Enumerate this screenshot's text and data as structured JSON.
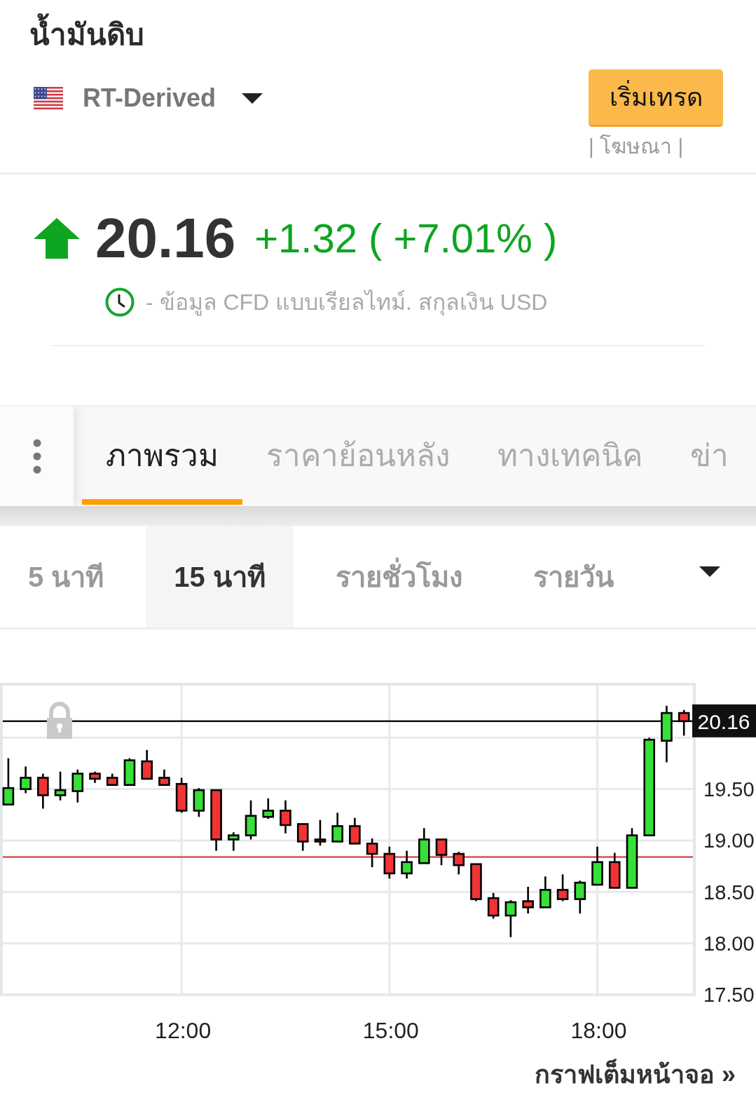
{
  "header": {
    "title": "น้ำมันดิบ",
    "source": "RT-Derived",
    "trade_button": "เริ่มเทรด",
    "ad_note": "| โฆษณา |"
  },
  "quote": {
    "rising": true,
    "price": "20.16",
    "change": "+1.32 ( +7.01% )",
    "info": "- ข้อมูล CFD แบบเรียลไทม์. สกุลเงิน USD"
  },
  "tabs": [
    {
      "label": "ภาพรวม",
      "selected": true
    },
    {
      "label": "ราคาย้อนหลัง",
      "selected": false
    },
    {
      "label": "ทางเทคนิค",
      "selected": false
    },
    {
      "label": "ข่า",
      "selected": false
    }
  ],
  "timeframes": [
    {
      "label": "5 นาที",
      "selected": false
    },
    {
      "label": "15 นาที",
      "selected": true
    },
    {
      "label": "รายชั่วโมง",
      "selected": false
    },
    {
      "label": "รายวัน",
      "selected": false
    }
  ],
  "chart": {
    "chart_data": {
      "type": "candlestick",
      "x": [
        9.5,
        9.75,
        10,
        10.25,
        10.5,
        10.75,
        11,
        11.25,
        11.5,
        11.75,
        12,
        12.25,
        12.5,
        12.75,
        13,
        13.25,
        13.5,
        13.75,
        14,
        14.25,
        14.5,
        14.75,
        15,
        15.25,
        15.5,
        15.75,
        16,
        16.25,
        16.5,
        16.75,
        17,
        17.25,
        17.5,
        17.75,
        18,
        18.25,
        18.5,
        18.75,
        19,
        19.25
      ],
      "ohlc": [
        [
          19.35,
          19.8,
          19.35,
          19.51
        ],
        [
          19.5,
          19.72,
          19.46,
          19.61
        ],
        [
          19.61,
          19.65,
          19.31,
          19.44
        ],
        [
          19.44,
          19.67,
          19.39,
          19.49
        ],
        [
          19.48,
          19.69,
          19.37,
          19.65
        ],
        [
          19.65,
          19.67,
          19.56,
          19.6
        ],
        [
          19.61,
          19.65,
          19.54,
          19.54
        ],
        [
          19.54,
          19.8,
          19.54,
          19.78
        ],
        [
          19.77,
          19.88,
          19.6,
          19.6
        ],
        [
          19.61,
          19.69,
          19.54,
          19.54
        ],
        [
          19.55,
          19.61,
          19.27,
          19.29
        ],
        [
          19.29,
          19.51,
          19.23,
          19.49
        ],
        [
          19.49,
          19.49,
          18.9,
          19.01
        ],
        [
          19.01,
          19.08,
          18.9,
          19.05
        ],
        [
          19.05,
          19.39,
          19.01,
          19.24
        ],
        [
          19.23,
          19.41,
          19.21,
          19.29
        ],
        [
          19.29,
          19.39,
          19.07,
          19.15
        ],
        [
          19.16,
          19.16,
          18.9,
          18.99
        ],
        [
          19.01,
          19.2,
          18.95,
          18.99
        ],
        [
          18.99,
          19.27,
          18.99,
          19.14
        ],
        [
          19.14,
          19.22,
          18.97,
          18.97
        ],
        [
          18.97,
          19.02,
          18.74,
          18.87
        ],
        [
          18.87,
          18.94,
          18.63,
          18.68
        ],
        [
          18.68,
          18.9,
          18.63,
          18.79
        ],
        [
          18.78,
          19.12,
          18.78,
          19.01
        ],
        [
          19.01,
          19.01,
          18.76,
          18.86
        ],
        [
          18.87,
          18.89,
          18.67,
          18.76
        ],
        [
          18.77,
          18.77,
          18.41,
          18.43
        ],
        [
          18.44,
          18.49,
          18.24,
          18.27
        ],
        [
          18.27,
          18.42,
          18.06,
          18.4
        ],
        [
          18.41,
          18.55,
          18.29,
          18.35
        ],
        [
          18.35,
          18.65,
          18.35,
          18.52
        ],
        [
          18.52,
          18.67,
          18.41,
          18.43
        ],
        [
          18.43,
          18.61,
          18.29,
          18.59
        ],
        [
          18.57,
          18.94,
          18.57,
          18.79
        ],
        [
          18.79,
          18.88,
          18.54,
          18.54
        ],
        [
          18.54,
          19.12,
          18.54,
          19.05
        ],
        [
          19.05,
          20.0,
          19.05,
          19.98
        ],
        [
          19.97,
          20.31,
          19.76,
          20.24
        ],
        [
          20.24,
          20.27,
          20.02,
          20.16
        ]
      ],
      "xlim": [
        9.4,
        19.4
      ],
      "ylim": [
        17.5,
        20.52
      ],
      "grid": true,
      "xticks": [
        {
          "value": 12,
          "label": "12:00"
        },
        {
          "value": 15,
          "label": "15:00"
        },
        {
          "value": 18,
          "label": "18:00"
        }
      ],
      "yticks": [
        {
          "value": 17.5,
          "label": "17.50"
        },
        {
          "value": 18,
          "label": "18.00"
        },
        {
          "value": 18.5,
          "label": "18.50"
        },
        {
          "value": 19,
          "label": "19.00"
        },
        {
          "value": 19.5,
          "label": "19.50"
        }
      ],
      "ref_lines": [
        {
          "axis": "y",
          "value": 18.84,
          "color": "#d9534f"
        },
        {
          "axis": "y",
          "value": 20.16,
          "color": "#111111",
          "label": "20.16"
        }
      ]
    }
  },
  "fullscreen_link": "กราฟเต็มหน้าจอ »"
}
